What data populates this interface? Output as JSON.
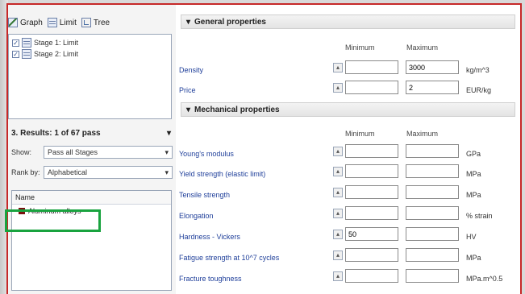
{
  "toolbar": {
    "graph": "Graph",
    "limit": "Limit",
    "tree": "Tree"
  },
  "stages": [
    "Stage 1: Limit",
    "Stage 2: Limit"
  ],
  "results": {
    "header": "3. Results: 1 of 67 pass",
    "show_label": "Show:",
    "show_value": "Pass all Stages",
    "rank_label": "Rank by:",
    "rank_value": "Alphabetical",
    "column_name": "Name",
    "items": [
      "Aluminum alloys"
    ]
  },
  "general": {
    "title": "General properties",
    "min_header": "Minimum",
    "max_header": "Maximum",
    "props": [
      {
        "name": "Density",
        "min": "",
        "max": "3000",
        "unit": "kg/m^3"
      },
      {
        "name": "Price",
        "min": "",
        "max": "2",
        "unit": "EUR/kg"
      }
    ]
  },
  "mechanical": {
    "title": "Mechanical properties",
    "min_header": "Minimum",
    "max_header": "Maximum",
    "props": [
      {
        "name": "Young's modulus",
        "min": "",
        "max": "",
        "unit": "GPa"
      },
      {
        "name": "Yield strength (elastic limit)",
        "min": "",
        "max": "",
        "unit": "MPa"
      },
      {
        "name": "Tensile strength",
        "min": "",
        "max": "",
        "unit": "MPa"
      },
      {
        "name": "Elongation",
        "min": "",
        "max": "",
        "unit": "% strain"
      },
      {
        "name": "Hardness - Vickers",
        "min": "50",
        "max": "",
        "unit": "HV"
      },
      {
        "name": "Fatigue strength at 10^7 cycles",
        "min": "",
        "max": "",
        "unit": "MPa"
      },
      {
        "name": "Fracture toughness",
        "min": "",
        "max": "",
        "unit": "MPa.m^0.5"
      }
    ]
  },
  "colors": {
    "frame": "#c62828",
    "highlight": "#19a33f",
    "link": "#1f3f9a",
    "swatch": "#7a1010"
  }
}
